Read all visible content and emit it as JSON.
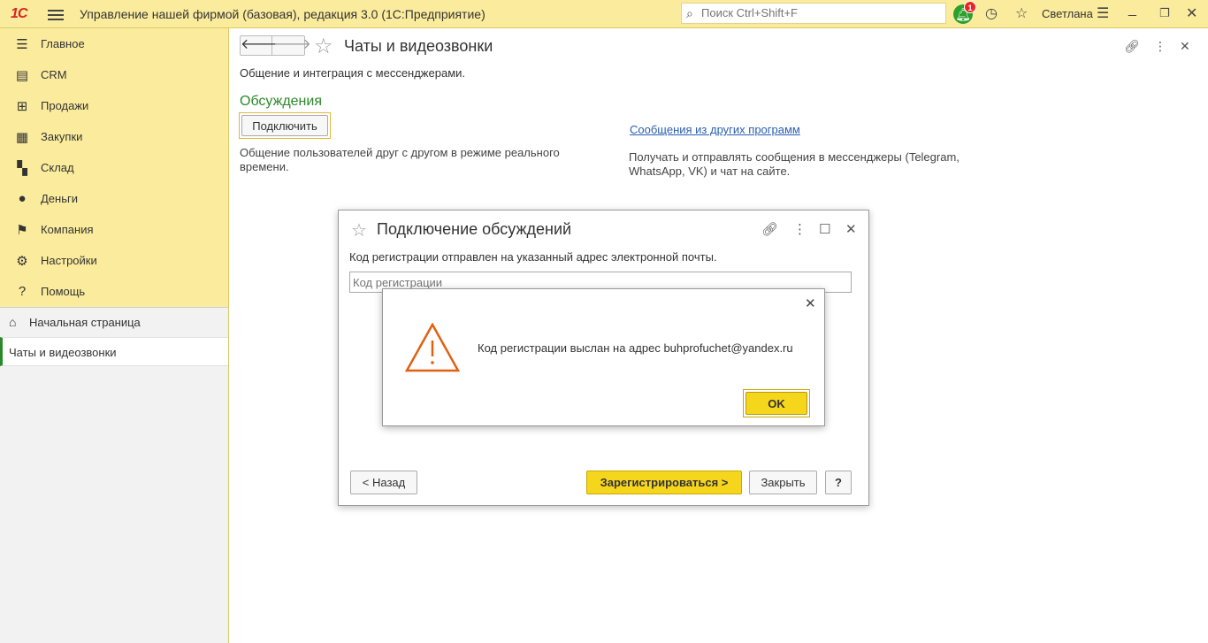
{
  "topbar": {
    "logo": "1С",
    "app_title": "Управление нашей фирмой (базовая), редакция 3.0  (1С:Предприятие)",
    "search_placeholder": "Поиск Ctrl+Shift+F",
    "notifications_count": "1",
    "user_name": "Светлана"
  },
  "sidebar": {
    "items": [
      {
        "label": "Главное",
        "icon": "hamburger-icon"
      },
      {
        "label": "CRM",
        "icon": "contacts-icon"
      },
      {
        "label": "Продажи",
        "icon": "basket-icon"
      },
      {
        "label": "Закупки",
        "icon": "cart-icon"
      },
      {
        "label": "Склад",
        "icon": "grid-icon"
      },
      {
        "label": "Деньги",
        "icon": "ruble-icon"
      },
      {
        "label": "Компания",
        "icon": "flag-icon"
      },
      {
        "label": "Настройки",
        "icon": "gear-icon"
      },
      {
        "label": "Помощь",
        "icon": "help-icon"
      }
    ],
    "home": "Начальная страница",
    "current": "Чаты и видеозвонки"
  },
  "main": {
    "title": "Чаты и видеозвонки",
    "subtitle": "Общение и интеграция с мессенджерами.",
    "section_title": "Обсуждения",
    "connect_button": "Подключить",
    "desc_left": "Общение пользователей друг с другом в режиме реального времени.",
    "link_right": "Сообщения из других программ",
    "desc_right": "Получать и отправлять сообщения в мессенджеры (Telegram, WhatsApp, VK) и чат на сайте."
  },
  "dialog": {
    "title": "Подключение обсуждений",
    "message": "Код регистрации отправлен на указанный адрес электронной почты.",
    "input_placeholder": "Код регистрации",
    "back_button": "< Назад",
    "register_button": "Зарегистрироваться >",
    "close_button": "Закрыть",
    "help_button": "?"
  },
  "alert": {
    "message": "Код регистрации выслан на адрес buhprofuchet@yandex.ru",
    "ok_button": "OK"
  }
}
